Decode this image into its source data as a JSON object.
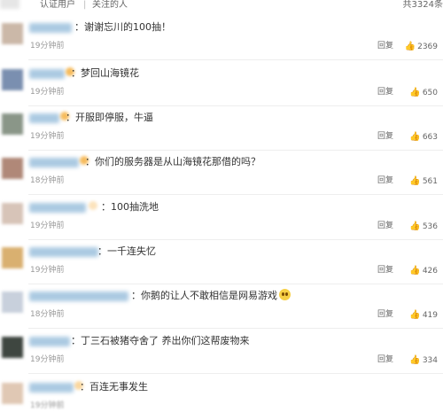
{
  "header": {
    "filter_verified": "认证用户",
    "separator": "|",
    "filter_following": "关注的人",
    "total": "共3324条"
  },
  "comments": [
    {
      "text": "谢谢忘川的100抽！",
      "time": "19分钟前",
      "reply": "回复",
      "likes": "2369",
      "avatar_color": "#cbb8a8"
    },
    {
      "text": "梦回山海镜花",
      "time": "19分钟前",
      "reply": "回复",
      "likes": "650",
      "avatar_color": "#7a8fb0"
    },
    {
      "text": "开服即停服，牛逼",
      "time": "19分钟前",
      "reply": "回复",
      "likes": "663",
      "avatar_color": "#8a9688"
    },
    {
      "text": "你们的服务器是从山海镜花那借的吗？",
      "time": "18分钟前",
      "reply": "回复",
      "likes": "561",
      "avatar_color": "#b08878"
    },
    {
      "text": "100抽洗地",
      "time": "19分钟前",
      "reply": "回复",
      "likes": "536",
      "avatar_color": "#d7c4b8"
    },
    {
      "text": "一千连失忆",
      "time": "19分钟前",
      "reply": "回复",
      "likes": "426",
      "avatar_color": "#d9b070"
    },
    {
      "text": "你鹅的让人不敢相信是网易游戏",
      "time": "18分钟前",
      "reply": "回复",
      "likes": "419",
      "avatar_color": "#c8d0dc"
    },
    {
      "text": "丁三石被猪夺舍了 养出你们这帮废物来",
      "time": "19分钟前",
      "reply": "回复",
      "likes": "334",
      "avatar_color": "#3e4640"
    },
    {
      "text": "百连无事发生",
      "time": "19分钟前",
      "reply": "回复",
      "likes": "",
      "avatar_color": "#e0c8b4"
    }
  ],
  "icons": {
    "like": "thumbs-up-icon",
    "emoji": "worried-face-emoji-icon",
    "verified": "verified-badge-icon"
  }
}
